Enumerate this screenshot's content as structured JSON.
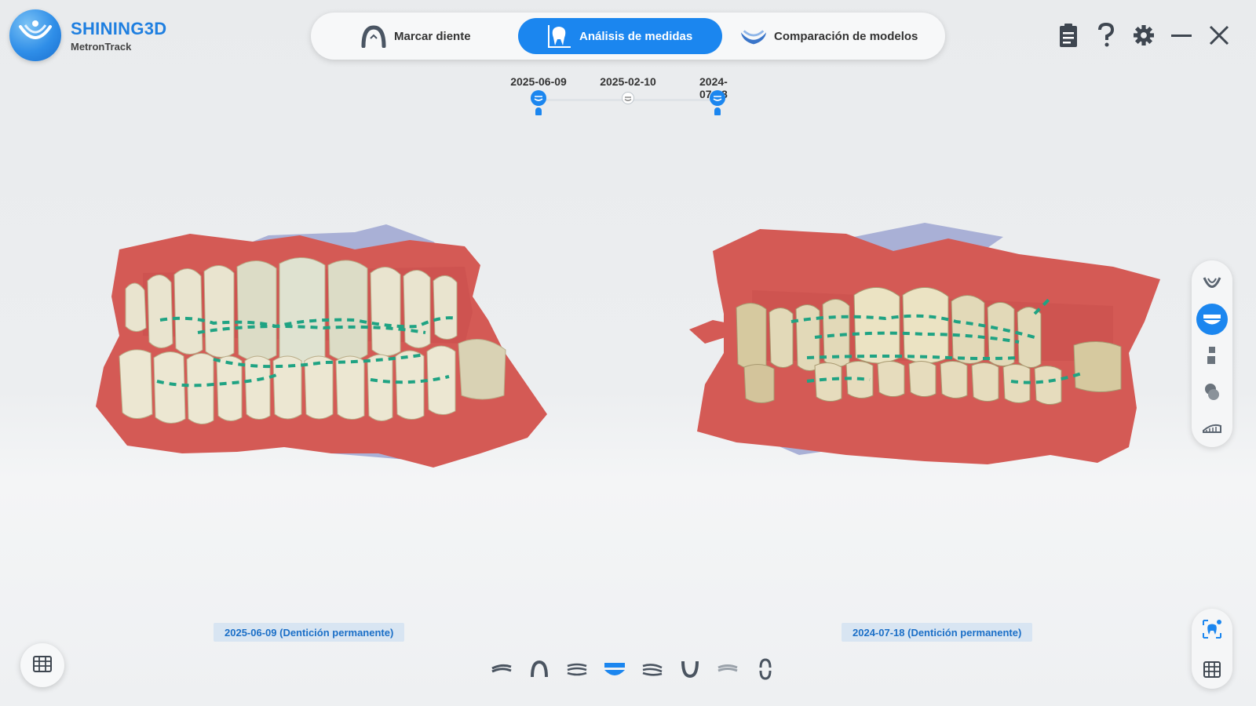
{
  "app": {
    "brand": "SHINING3D",
    "product": "MetronTrack"
  },
  "tabs": [
    {
      "label": "Marcar diente",
      "icon": "arch-icon",
      "active": false
    },
    {
      "label": "Análisis de medidas",
      "icon": "tooth-measure-icon",
      "active": true
    },
    {
      "label": "Comparación de modelos",
      "icon": "model-compare-icon",
      "active": false
    }
  ],
  "toolbar_right": [
    "clipboard-icon",
    "help-icon",
    "gear-icon",
    "minimize-icon",
    "close-icon"
  ],
  "timeline": {
    "dates": [
      "2025-06-09",
      "2025-02-10",
      "2024-07-18"
    ],
    "selected": [
      "2025-06-09",
      "2024-07-18"
    ]
  },
  "models": {
    "left_caption": "2025-06-09 (Dentición permanente)",
    "right_caption": "2024-07-18 (Dentición permanente)"
  },
  "right_tools": [
    "lower-arch-icon",
    "front-view-icon",
    "side-view-icon",
    "occlusal-view-icon",
    "measure-ruler-icon"
  ],
  "right_tools_active": "front-view-icon",
  "bottom_right_tools": [
    "tooth-scan-icon",
    "grid-icon"
  ],
  "bottom_views": [
    "left-view-icon",
    "upper-arch-icon",
    "right-angle-icon",
    "front-view-icon",
    "right-view-icon",
    "lower-arch-icon",
    "back-view-icon",
    "open-bite-icon"
  ],
  "bottom_views_active": "front-view-icon",
  "colors": {
    "accent": "#1b86ef",
    "gum": "#d9605a",
    "tooth": "#e8e2c8",
    "measure_line": "#1fa383"
  }
}
